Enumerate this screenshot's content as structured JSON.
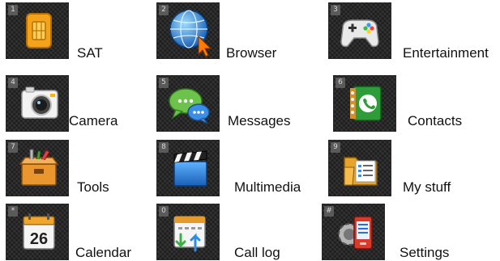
{
  "items": [
    {
      "key": "1",
      "label": "SAT",
      "icon": "sim-card-icon"
    },
    {
      "key": "2",
      "label": "Browser",
      "icon": "globe-icon"
    },
    {
      "key": "3",
      "label": "Entertainment",
      "icon": "gamepad-icon"
    },
    {
      "key": "4",
      "label": "Camera",
      "icon": "camera-icon"
    },
    {
      "key": "5",
      "label": "Messages",
      "icon": "chat-bubbles-icon"
    },
    {
      "key": "6",
      "label": "Contacts",
      "icon": "address-book-icon"
    },
    {
      "key": "7",
      "label": "Tools",
      "icon": "toolbox-icon"
    },
    {
      "key": "8",
      "label": "Multimedia",
      "icon": "clapperboard-icon"
    },
    {
      "key": "9",
      "label": "My stuff",
      "icon": "folder-icon"
    },
    {
      "key": "*",
      "label": "Calendar",
      "icon": "calendar-icon"
    },
    {
      "key": "0",
      "label": "Call log",
      "icon": "call-log-icon"
    },
    {
      "key": "#",
      "label": "Settings",
      "icon": "settings-icon"
    }
  ],
  "calendar_day": "26"
}
